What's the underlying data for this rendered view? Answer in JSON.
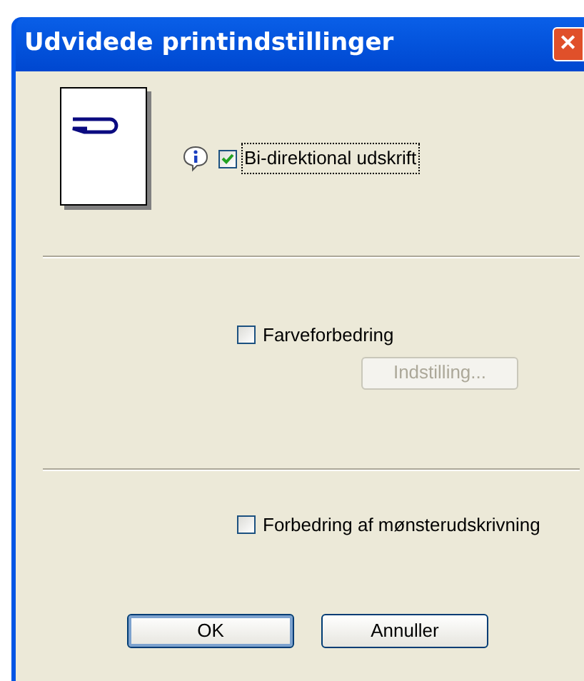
{
  "window": {
    "title": "Udvidede printindstillinger",
    "close": "✕"
  },
  "options": [
    {
      "label": "Bi-direktional udskrift",
      "checked": true,
      "focused": true,
      "info": true
    },
    {
      "label": "Farveforbedring",
      "checked": false,
      "focused": false,
      "button": {
        "label": "Indstilling...",
        "disabled": true
      }
    },
    {
      "label": "Forbedring af mønsterudskrivning",
      "checked": false,
      "focused": false
    }
  ],
  "buttons": [
    {
      "label": "OK",
      "default": true
    },
    {
      "label": "Annuller",
      "default": false
    }
  ]
}
